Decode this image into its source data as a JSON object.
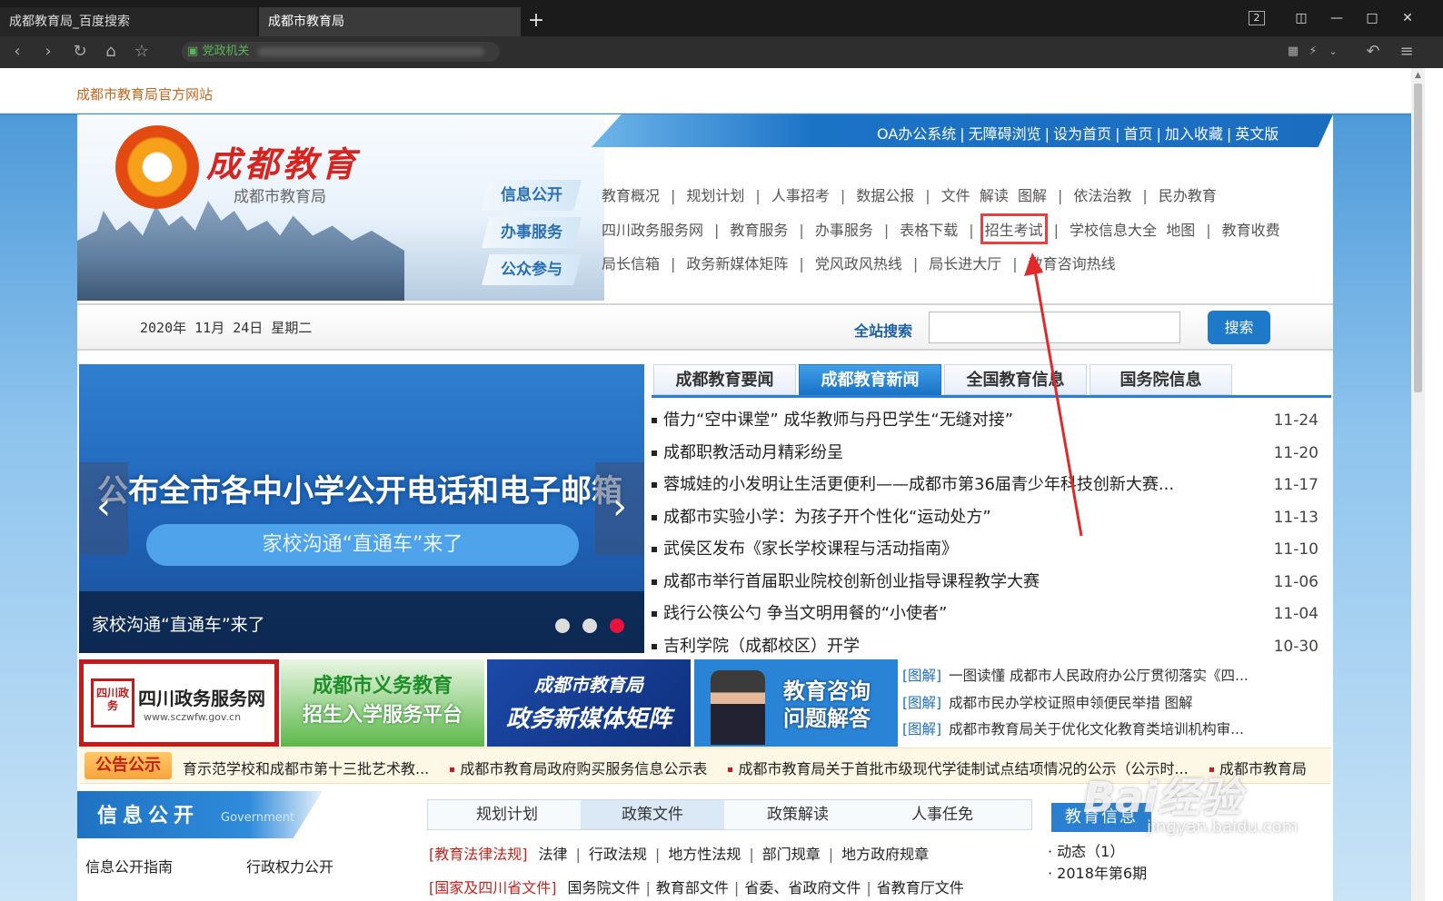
{
  "browser": {
    "tabs": [
      {
        "label": "成都教育局_百度搜索"
      },
      {
        "label": "成都市教育局"
      }
    ],
    "new_tab": "+",
    "tab_count": "2",
    "address_prefix": "党政机关"
  },
  "site": {
    "site_name": "成都市教育局官方网站",
    "logo_title": "成都教育",
    "logo_subtitle": "成都市教育局",
    "top_links": [
      "OA办公系统",
      "无障碍浏览",
      "设为首页",
      "首页",
      "加入收藏",
      "英文版"
    ],
    "nav_tags": [
      "信息公开",
      "办事服务",
      "公众参与"
    ],
    "nav_row1": [
      "教育概况",
      "规划计划",
      "人事招考",
      "数据公报",
      "文件",
      "解读",
      "图解",
      "依法治教",
      "民办教育"
    ],
    "nav_row2": [
      "四川政务服务网",
      "教育服务",
      "办事服务",
      "表格下载",
      "招生考试",
      "学校信息大全",
      "地图",
      "教育收费"
    ],
    "nav_row3": [
      "局长信箱",
      "政务新媒体矩阵",
      "党风政风热线",
      "局长进大厅",
      "教育咨询热线"
    ]
  },
  "search": {
    "date": "2020年 11月 24日 星期二",
    "label": "全站搜索",
    "placeholder": "",
    "button": "搜索"
  },
  "slider": {
    "headline": "公布全市各中小学公开电话和电子邮箱",
    "pill": "家校沟通“直通车”来了",
    "caption": "家校沟通“直通车”来了",
    "prev": "‹",
    "next": "›",
    "active_dot": 3
  },
  "news": {
    "tabs": [
      "成都教育要闻",
      "成都教育新闻",
      "全国教育信息",
      "国务院信息"
    ],
    "active_tab": 1,
    "items": [
      {
        "title": "借力“空中课堂” 成华教师与丹巴学生“无缝对接”",
        "date": "11-24"
      },
      {
        "title": "成都职教活动月精彩纷呈",
        "date": "11-20"
      },
      {
        "title": "蓉城娃的小发明让生活更便利——成都市第36届青少年科技创新大赛...",
        "date": "11-17"
      },
      {
        "title": "成都市实验小学：为孩子开个性化“运动处方”",
        "date": "11-13"
      },
      {
        "title": "武侯区发布《家长学校课程与活动指南》",
        "date": "11-10"
      },
      {
        "title": "成都市举行首届职业院校创新创业指导课程教学大赛",
        "date": "11-06"
      },
      {
        "title": "践行公筷公勺 争当文明用餐的“小使者”",
        "date": "11-04"
      },
      {
        "title": "吉利学院（成都校区）开学",
        "date": "10-30"
      }
    ]
  },
  "promos": {
    "p1_seal": "四川政务",
    "p1_title": "四川政务服务网",
    "p1_url": "www.sczwfw.gov.cn",
    "p2_line1": "成都市义务教育",
    "p2_line2": "招生入学服务平台",
    "p3_line1": "成都市教育局",
    "p3_line2": "政务新媒体矩阵",
    "p4_line1": "教育咨询",
    "p4_line2": "问题解答"
  },
  "tujie": [
    {
      "tag": "[图解]",
      "text": "一图读懂 成都市人民政府办公厅贯彻落实《四..."
    },
    {
      "tag": "[图解]",
      "text": "成都市民办学校证照申领便民举措 图解"
    },
    {
      "tag": "[图解]",
      "text": "成都市教育局关于优化文化教育类培训机构审..."
    }
  ],
  "notice": {
    "label": "公告公示",
    "items": [
      "育示范学校和成都市第十三批艺术教...",
      "成都市教育局政府购买服务信息公示表",
      "成都市教育局关于首批市级现代学徒制试点结项情况的公示（公示时...",
      "成都市教育局"
    ]
  },
  "info": {
    "title": "信息公开",
    "title_en": "Government",
    "links": [
      "信息公开指南",
      "行政权力公开"
    ]
  },
  "policy": {
    "tabs": [
      "规划计划",
      "政策文件",
      "政策解读",
      "人事任免"
    ],
    "active_tab": 1,
    "row1_label": "[教育法律法规]",
    "row1_items": [
      "法律",
      "行政法规",
      "地方性法规",
      "部门规章",
      "地方政府规章"
    ],
    "row2_label": "[国家及四川省文件]",
    "row2_items": [
      "国务院文件",
      "教育部文件",
      "省委、省政府文件",
      "省教育厅文件"
    ]
  },
  "jingyan": {
    "title": "教育信息",
    "items": [
      "· 动态（1）",
      "· 2018年第6期"
    ]
  },
  "watermark": {
    "brand": "Bai经验",
    "url": "jingyan.baidu.com"
  },
  "colors": {
    "accent": "#1e79c9",
    "highlight": "#e64040",
    "brand_red": "#d7241f"
  }
}
